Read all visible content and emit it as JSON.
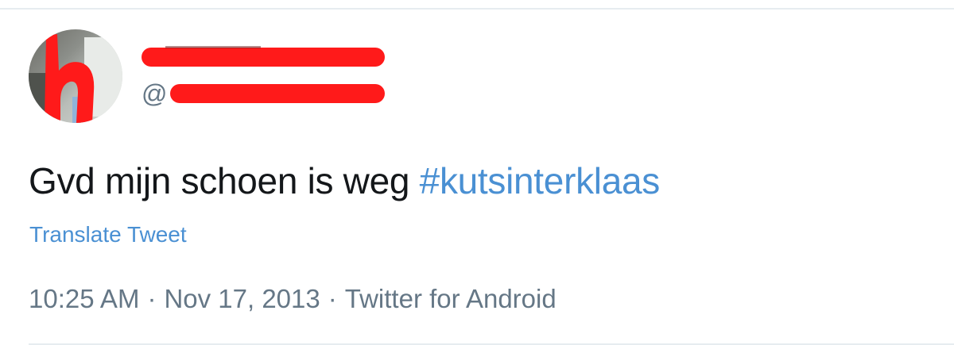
{
  "tweet": {
    "author": {
      "avatar_icon": "avatar-photo",
      "handle_prefix": "@"
    },
    "text_main": "Gvd mijn schoen is weg ",
    "hashtag": "#kutsinterklaas",
    "translate_label": "Translate Tweet",
    "time": "10:25 AM",
    "separator": "·",
    "date": "Nov 17, 2013",
    "source": "Twitter for Android"
  },
  "colors": {
    "link": "#4a90d3",
    "text": "#14171a",
    "secondary": "#657786",
    "redaction": "#ff0000",
    "divider": "#e6ecf0"
  }
}
